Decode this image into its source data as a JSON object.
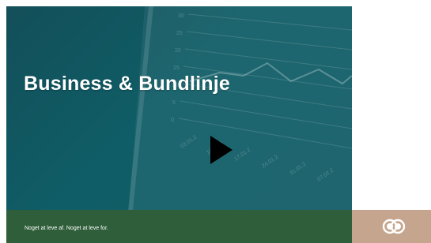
{
  "video": {
    "title": "Business & Bundlinje",
    "play_button": "play-icon",
    "background_chart": {
      "y_ticks": [
        "30",
        "25",
        "20",
        "15",
        "10",
        "5",
        "0"
      ],
      "x_ticks": [
        "03.01.2",
        "10.01.2",
        "17.01.2",
        "24.01.2",
        "31.01.2",
        "07.02.2"
      ]
    }
  },
  "footer": {
    "tagline": "Noget at leve af. Noget at leve for.",
    "logo": "infinity-ring-logo-icon"
  },
  "colors": {
    "video_bg": "#115c66",
    "footer_bg": "#2f5e3a",
    "logo_bg": "#c6a58e"
  }
}
